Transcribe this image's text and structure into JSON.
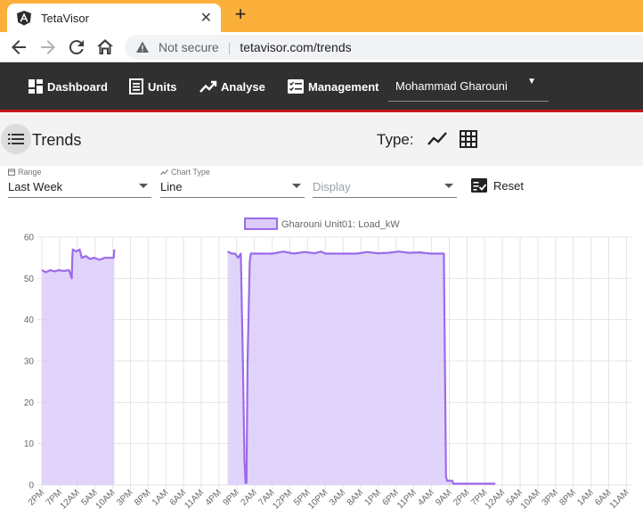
{
  "browser": {
    "tab_title": "TetaVisor",
    "tab_close": "✕",
    "new_tab": "+",
    "not_secure": "Not secure",
    "url": "tetavisor.com/trends"
  },
  "nav": {
    "dashboard": "Dashboard",
    "units": "Units",
    "analyse": "Analyse",
    "management": "Management",
    "user": "Mohammad Gharouni"
  },
  "header": {
    "title": "Trends",
    "type_label": "Type:"
  },
  "filters": {
    "range_label": "Range",
    "range_value": "Last Week",
    "chart_type_label": "Chart Type",
    "chart_type_value": "Line",
    "display_placeholder": "Display",
    "reset_label": "Reset"
  },
  "colors": {
    "tabbar": "#fbb03b",
    "nav_bg": "#303030",
    "nav_accent": "#c61a1a",
    "series_line": "#9c6bea",
    "series_fill": "#dcccfa"
  },
  "chart_data": {
    "type": "area",
    "series": [
      {
        "name": "Gharouni Unit01: Load_kW",
        "segments": [
          [
            [
              0.0,
              52
            ],
            [
              0.4,
              51.5
            ],
            [
              0.8,
              52
            ],
            [
              1.2,
              51.7
            ],
            [
              1.6,
              52
            ],
            [
              2.1,
              51.8
            ],
            [
              2.6,
              52
            ],
            [
              2.85,
              50
            ],
            [
              2.9,
              55
            ],
            [
              2.95,
              57
            ],
            [
              3.3,
              56.5
            ],
            [
              3.6,
              57
            ],
            [
              3.8,
              55
            ],
            [
              4.2,
              55.4
            ],
            [
              4.6,
              54.7
            ],
            [
              5,
              55
            ],
            [
              5.5,
              54.5
            ],
            [
              6,
              55
            ],
            [
              6.5,
              55
            ],
            [
              6.85,
              55
            ],
            [
              6.9,
              57
            ]
          ],
          [
            [
              17.7,
              56.5
            ],
            [
              18.1,
              56
            ],
            [
              18.4,
              56
            ],
            [
              18.7,
              55
            ],
            [
              18.95,
              56
            ],
            [
              19.15,
              30
            ],
            [
              19.3,
              6
            ],
            [
              19.4,
              0.5
            ],
            [
              19.5,
              0.5
            ],
            [
              19.6,
              30
            ],
            [
              19.8,
              54
            ],
            [
              19.9,
              56
            ],
            [
              21,
              56
            ],
            [
              22,
              56
            ],
            [
              23,
              56.5
            ],
            [
              24,
              56
            ],
            [
              25,
              56.4
            ],
            [
              26,
              56.1
            ],
            [
              26.6,
              56.5
            ],
            [
              27,
              56
            ],
            [
              28,
              56
            ],
            [
              29,
              56
            ],
            [
              30,
              56
            ],
            [
              31,
              56.4
            ],
            [
              32,
              56.1
            ],
            [
              33,
              56.2
            ],
            [
              34,
              56.5
            ],
            [
              35,
              56.2
            ],
            [
              36,
              56.3
            ],
            [
              37,
              56
            ],
            [
              38,
              56
            ],
            [
              38.3,
              56
            ],
            [
              38.5,
              2
            ],
            [
              38.6,
              1
            ],
            [
              39.1,
              1
            ],
            [
              39.2,
              0.3
            ],
            [
              43.2,
              0.3
            ]
          ]
        ]
      }
    ],
    "x_tick_labels": [
      "2PM",
      "7PM",
      "12AM",
      "5AM",
      "10AM",
      "3PM",
      "8PM",
      "1AM",
      "6AM",
      "11AM",
      "4PM",
      "9PM",
      "2AM",
      "7AM",
      "12PM",
      "5PM",
      "10PM",
      "3AM",
      "8AM",
      "1PM",
      "6PM",
      "11PM",
      "4AM",
      "9AM",
      "2PM",
      "7PM",
      "12AM",
      "5AM",
      "10AM",
      "3PM",
      "8PM",
      "1AM",
      "6AM",
      "11AM"
    ],
    "xlim": [
      0,
      56.25
    ],
    "ylim": [
      0,
      60
    ],
    "y_ticks": [
      0,
      10,
      20,
      30,
      40,
      50,
      60
    ],
    "legend_position": "top-center",
    "grid": true
  }
}
